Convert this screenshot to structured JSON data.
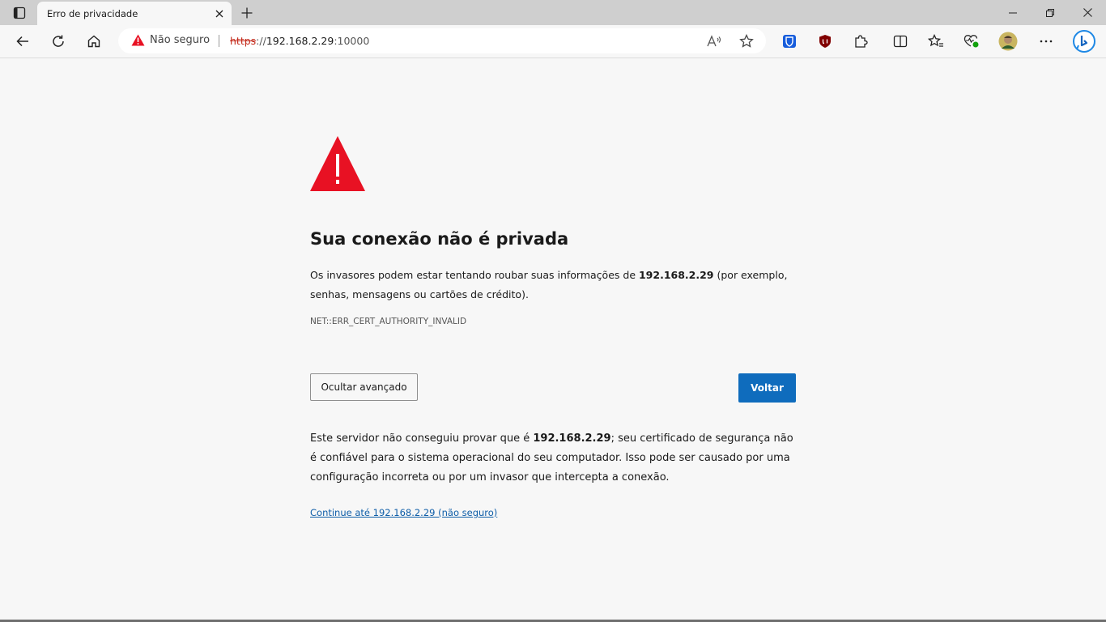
{
  "tab": {
    "title": "Erro de privacidade"
  },
  "address_bar": {
    "security_label": "Não seguro",
    "url_scheme": "https",
    "url_rest": "://",
    "url_host": "192.168.2.29",
    "url_port": ":10000"
  },
  "page": {
    "heading": "Sua conexão não é privada",
    "desc_before": "Os invasores podem estar tentando roubar suas informações de ",
    "desc_host": "192.168.2.29",
    "desc_after": " (por exemplo, senhas, mensagens ou cartões de crédito).",
    "error_code": "NET::ERR_CERT_AUTHORITY_INVALID",
    "hide_advanced_label": "Ocultar avançado",
    "back_label": "Voltar",
    "details_before": "Este servidor não conseguiu provar que é ",
    "details_host": "192.168.2.29",
    "details_after": "; seu certificado de segurança não é confiável para o sistema operacional do seu computador. Isso pode ser causado por uma configuração incorreta ou por um invasor que intercepta a conexão.",
    "proceed_link": "Continue até 192.168.2.29 (não seguro)"
  },
  "colors": {
    "warning_red": "#e81123",
    "primary_button": "#0f6cbd",
    "link": "#0f5ea8"
  }
}
